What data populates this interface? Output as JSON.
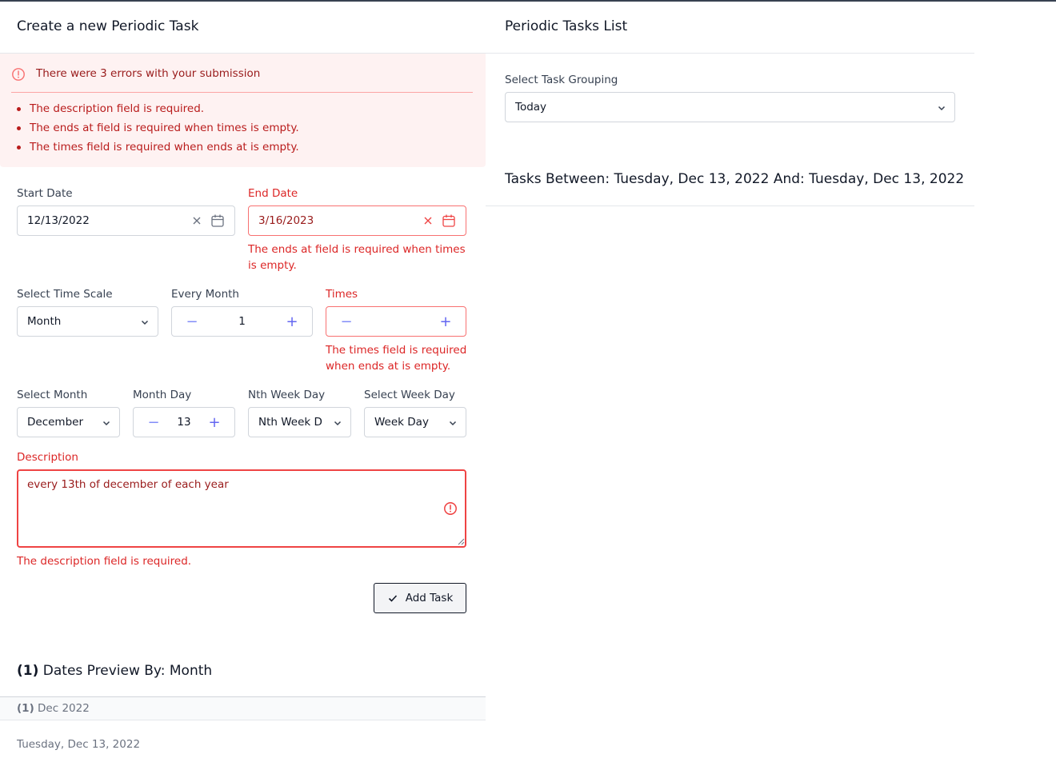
{
  "left": {
    "title": "Create a new Periodic Task",
    "error_banner": {
      "heading": "There were 3 errors with your submission",
      "items": [
        "The description field is required.",
        "The ends at field is required when times is empty.",
        "The times field is required when ends at is empty."
      ]
    },
    "start_date": {
      "label": "Start Date",
      "value": "12/13/2022"
    },
    "end_date": {
      "label": "End Date",
      "value": "3/16/2023",
      "error": "The ends at field is required when times is empty."
    },
    "time_scale": {
      "label": "Select Time Scale",
      "value": "Month"
    },
    "every_month": {
      "label": "Every Month",
      "value": "1"
    },
    "times": {
      "label": "Times",
      "value": "",
      "error": "The times field is required when ends at is empty."
    },
    "select_month": {
      "label": "Select Month",
      "value": "December"
    },
    "month_day": {
      "label": "Month Day",
      "value": "13"
    },
    "nth_week_day": {
      "label": "Nth Week Day",
      "value": "Nth Week D"
    },
    "week_day": {
      "label": "Select Week Day",
      "value": "Week Day"
    },
    "description": {
      "label": "Description",
      "value": "every 13th of december of each year",
      "error": "The description field is required."
    },
    "add_task_label": "Add Task",
    "preview": {
      "count": "(1)",
      "title": "Dates Preview By: Month",
      "group_count": "(1)",
      "group_label": "Dec 2022",
      "dates": [
        "Tuesday, Dec 13, 2022"
      ]
    }
  },
  "right": {
    "title": "Periodic Tasks List",
    "grouping": {
      "label": "Select Task Grouping",
      "value": "Today"
    },
    "range_title": "Tasks Between: Tuesday, Dec 13, 2022 And: Tuesday, Dec 13, 2022"
  },
  "colors": {
    "error": "#dc2626",
    "error_bg": "#fef2f2",
    "accent": "#6366f1"
  }
}
